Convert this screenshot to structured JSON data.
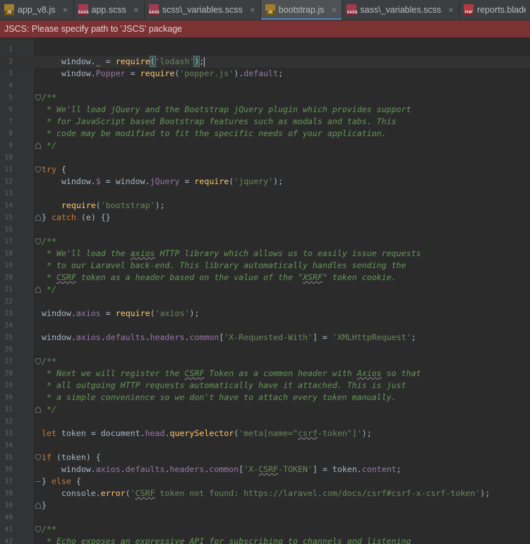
{
  "tabs": [
    {
      "label": "app_v8.js",
      "icon": "js",
      "icon_text": "JS",
      "active": false
    },
    {
      "label": "app.scss",
      "icon": "scss",
      "icon_text": "SASS",
      "active": false
    },
    {
      "label": "scss\\_variables.scss",
      "icon": "scss",
      "icon_text": "SASS",
      "active": false
    },
    {
      "label": "bootstrap.js",
      "icon": "js",
      "icon_text": "JS",
      "active": true
    },
    {
      "label": "sass\\_variables.scss",
      "icon": "scss",
      "icon_text": "SASS",
      "active": false
    },
    {
      "label": "reports.blade.php",
      "icon": "php",
      "icon_text": "PHP",
      "active": false
    }
  ],
  "close_glyph": "×",
  "notification": {
    "text": "JSCS: Please specify path to 'JSCS' package"
  },
  "colors": {
    "accent_tab": "#4a88c7",
    "notification_bg": "#7a3233",
    "keyword": "#cc7832",
    "string": "#6a8759",
    "function": "#ffc66d",
    "comment": "#629755",
    "property": "#9876aa"
  },
  "editor": {
    "current_line": 2,
    "lines": [
      {
        "n": "1",
        "fold": "",
        "tokens": []
      },
      {
        "n": "2",
        "fold": "",
        "tokens": [
          [
            "p",
            "    window."
          ],
          [
            "fn",
            "_"
          ],
          [
            "p",
            " = "
          ],
          [
            "fn",
            "require"
          ],
          [
            "bm",
            "("
          ],
          [
            "str",
            "'lodash'"
          ],
          [
            "bm",
            ")"
          ],
          [
            "p",
            ";"
          ],
          [
            "caret",
            ""
          ]
        ]
      },
      {
        "n": "3",
        "fold": "",
        "tokens": [
          [
            "p",
            "    window."
          ],
          [
            "prop",
            "Popper"
          ],
          [
            "p",
            " = "
          ],
          [
            "fn",
            "require"
          ],
          [
            "p",
            "("
          ],
          [
            "str",
            "'popper.js'"
          ],
          [
            "p",
            ")."
          ],
          [
            "prop",
            "default"
          ],
          [
            "p",
            ";"
          ]
        ]
      },
      {
        "n": "4",
        "fold": "",
        "tokens": []
      },
      {
        "n": "5",
        "fold": "open",
        "tokens": [
          [
            "cm",
            "/**"
          ]
        ]
      },
      {
        "n": "6",
        "fold": "",
        "tokens": [
          [
            "cm",
            " * We'll load jQuery and the Bootstrap jQuery plugin which provides support"
          ]
        ]
      },
      {
        "n": "7",
        "fold": "",
        "tokens": [
          [
            "cm",
            " * for JavaScript based Bootstrap features such as modals and tabs. This"
          ]
        ]
      },
      {
        "n": "8",
        "fold": "",
        "tokens": [
          [
            "cm",
            " * code may be modified to fit the specific needs of your application."
          ]
        ]
      },
      {
        "n": "9",
        "fold": "close",
        "tokens": [
          [
            "cm",
            " */"
          ]
        ]
      },
      {
        "n": "10",
        "fold": "",
        "tokens": []
      },
      {
        "n": "11",
        "fold": "open",
        "tokens": [
          [
            "kw",
            "try"
          ],
          [
            "p",
            " {"
          ]
        ]
      },
      {
        "n": "12",
        "fold": "",
        "tokens": [
          [
            "p",
            "    window."
          ],
          [
            "prop",
            "$"
          ],
          [
            "p",
            " = window."
          ],
          [
            "prop",
            "jQuery"
          ],
          [
            "p",
            " = "
          ],
          [
            "fn",
            "require"
          ],
          [
            "p",
            "("
          ],
          [
            "str",
            "'jquery'"
          ],
          [
            "p",
            ");"
          ]
        ]
      },
      {
        "n": "13",
        "fold": "",
        "tokens": []
      },
      {
        "n": "14",
        "fold": "",
        "tokens": [
          [
            "p",
            "    "
          ],
          [
            "fn",
            "require"
          ],
          [
            "p",
            "("
          ],
          [
            "str",
            "'bootstrap'"
          ],
          [
            "p",
            ");"
          ]
        ]
      },
      {
        "n": "15",
        "fold": "close",
        "tokens": [
          [
            "p",
            "} "
          ],
          [
            "kw",
            "catch"
          ],
          [
            "p",
            " (e) {}"
          ]
        ]
      },
      {
        "n": "16",
        "fold": "",
        "tokens": []
      },
      {
        "n": "17",
        "fold": "open",
        "tokens": [
          [
            "cm",
            "/**"
          ]
        ]
      },
      {
        "n": "18",
        "fold": "",
        "tokens": [
          [
            "cm",
            " * We'll load the "
          ],
          [
            "cmsq",
            "axios"
          ],
          [
            "cm",
            " HTTP library which allows us to easily issue requests"
          ]
        ]
      },
      {
        "n": "19",
        "fold": "",
        "tokens": [
          [
            "cm",
            " * to our Laravel back-end. This library automatically handles sending the"
          ]
        ]
      },
      {
        "n": "20",
        "fold": "",
        "tokens": [
          [
            "cm",
            " * "
          ],
          [
            "cmsq",
            "CSRF"
          ],
          [
            "cm",
            " token as a header based on the value of the \""
          ],
          [
            "cmsq",
            "XSRF"
          ],
          [
            "cm",
            "\" token cookie."
          ]
        ]
      },
      {
        "n": "21",
        "fold": "close",
        "tokens": [
          [
            "cm",
            " */"
          ]
        ]
      },
      {
        "n": "22",
        "fold": "",
        "tokens": []
      },
      {
        "n": "23",
        "fold": "",
        "tokens": [
          [
            "p",
            "window."
          ],
          [
            "prop",
            "axios"
          ],
          [
            "p",
            " = "
          ],
          [
            "fn",
            "require"
          ],
          [
            "p",
            "("
          ],
          [
            "str",
            "'axios'"
          ],
          [
            "p",
            ");"
          ]
        ]
      },
      {
        "n": "24",
        "fold": "",
        "tokens": []
      },
      {
        "n": "25",
        "fold": "",
        "tokens": [
          [
            "p",
            "window."
          ],
          [
            "prop",
            "axios"
          ],
          [
            "p",
            "."
          ],
          [
            "prop",
            "defaults"
          ],
          [
            "p",
            "."
          ],
          [
            "prop",
            "headers"
          ],
          [
            "p",
            "."
          ],
          [
            "prop",
            "common"
          ],
          [
            "p",
            "["
          ],
          [
            "str",
            "'X-Requested-With'"
          ],
          [
            "p",
            "] = "
          ],
          [
            "str",
            "'XMLHttpRequest'"
          ],
          [
            "p",
            ";"
          ]
        ]
      },
      {
        "n": "26",
        "fold": "",
        "tokens": []
      },
      {
        "n": "27",
        "fold": "open",
        "tokens": [
          [
            "cm",
            "/**"
          ]
        ]
      },
      {
        "n": "28",
        "fold": "",
        "tokens": [
          [
            "cm",
            " * Next we will register the "
          ],
          [
            "cmsq",
            "CSRF"
          ],
          [
            "cm",
            " Token as a common header with "
          ],
          [
            "cmsq",
            "Axios"
          ],
          [
            "cm",
            " so that"
          ]
        ]
      },
      {
        "n": "29",
        "fold": "",
        "tokens": [
          [
            "cm",
            " * all outgoing HTTP requests automatically have it attached. This is just"
          ]
        ]
      },
      {
        "n": "30",
        "fold": "",
        "tokens": [
          [
            "cm",
            " * a simple convenience so we don't have to attach every token manually."
          ]
        ]
      },
      {
        "n": "31",
        "fold": "close",
        "tokens": [
          [
            "cm",
            " */"
          ]
        ]
      },
      {
        "n": "32",
        "fold": "",
        "tokens": []
      },
      {
        "n": "33",
        "fold": "",
        "tokens": [
          [
            "kw",
            "let"
          ],
          [
            "p",
            " token = document."
          ],
          [
            "prop",
            "head"
          ],
          [
            "p",
            "."
          ],
          [
            "fn",
            "querySelector"
          ],
          [
            "p",
            "("
          ],
          [
            "str",
            "'meta[name=\""
          ],
          [
            "strsq",
            "csrf"
          ],
          [
            "str",
            "-token\"]'"
          ],
          [
            "p",
            ");"
          ]
        ]
      },
      {
        "n": "34",
        "fold": "",
        "tokens": []
      },
      {
        "n": "35",
        "fold": "open",
        "tokens": [
          [
            "kw",
            "if"
          ],
          [
            "p",
            " (token) {"
          ]
        ]
      },
      {
        "n": "36",
        "fold": "",
        "tokens": [
          [
            "p",
            "    window."
          ],
          [
            "prop",
            "axios"
          ],
          [
            "p",
            "."
          ],
          [
            "prop",
            "defaults"
          ],
          [
            "p",
            "."
          ],
          [
            "prop",
            "headers"
          ],
          [
            "p",
            "."
          ],
          [
            "prop",
            "common"
          ],
          [
            "p",
            "["
          ],
          [
            "str",
            "'X-"
          ],
          [
            "strsq",
            "CSRF"
          ],
          [
            "str",
            "-TOKEN'"
          ],
          [
            "p",
            "] = token."
          ],
          [
            "prop",
            "content"
          ],
          [
            "p",
            ";"
          ]
        ]
      },
      {
        "n": "37",
        "fold": "mid",
        "tokens": [
          [
            "p",
            "} "
          ],
          [
            "kw",
            "else"
          ],
          [
            "p",
            " {"
          ]
        ]
      },
      {
        "n": "38",
        "fold": "",
        "tokens": [
          [
            "p",
            "    console."
          ],
          [
            "fn",
            "error"
          ],
          [
            "p",
            "("
          ],
          [
            "str",
            "'"
          ],
          [
            "strsq",
            "CSRF"
          ],
          [
            "str",
            " token not found: https://laravel.com/docs/csrf#csrf-x-csrf-token'"
          ],
          [
            "p",
            ");"
          ]
        ]
      },
      {
        "n": "39",
        "fold": "close",
        "tokens": [
          [
            "p",
            "}"
          ]
        ]
      },
      {
        "n": "40",
        "fold": "",
        "tokens": []
      },
      {
        "n": "41",
        "fold": "open",
        "tokens": [
          [
            "cm",
            "/**"
          ]
        ]
      },
      {
        "n": "42",
        "fold": "",
        "tokens": [
          [
            "cm",
            " * Echo exposes an expressive API for subscribing to channels and listening"
          ]
        ]
      }
    ]
  }
}
